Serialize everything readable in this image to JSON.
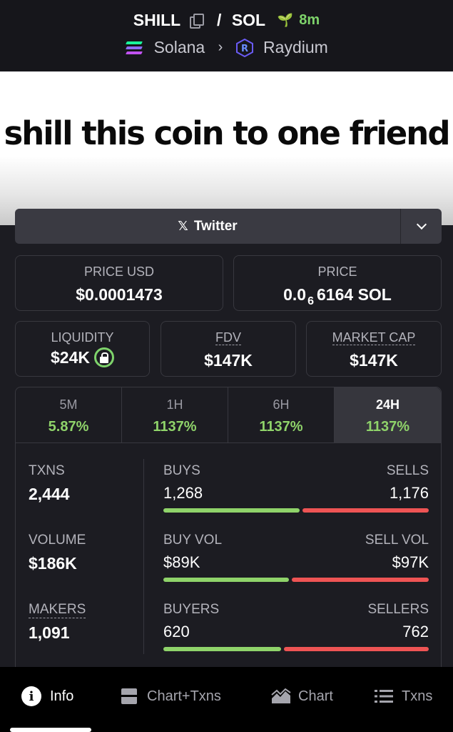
{
  "header": {
    "token": "SHILL",
    "separator": "/",
    "quote": "SOL",
    "age": "8m",
    "chain": "Solana",
    "dex": "Raydium"
  },
  "banner": {
    "text": "shill this coin to one friend"
  },
  "social": {
    "label": "Twitter"
  },
  "price_usd": {
    "label": "PRICE USD",
    "value": "$0.0001473"
  },
  "price_native": {
    "label": "PRICE",
    "prefix": "0.0",
    "zeros": "6",
    "digits": "6164 SOL"
  },
  "liquidity": {
    "label": "LIQUIDITY",
    "value": "$24K"
  },
  "fdv": {
    "label": "FDV",
    "value": "$147K"
  },
  "market_cap": {
    "label": "MARKET CAP",
    "value": "$147K"
  },
  "tabs": [
    {
      "label": "5M",
      "value": "5.87%"
    },
    {
      "label": "1H",
      "value": "1137%"
    },
    {
      "label": "6H",
      "value": "1137%"
    },
    {
      "label": "24H",
      "value": "1137%"
    }
  ],
  "stats": {
    "txns": {
      "label": "TXNS",
      "value": "2,444"
    },
    "volume": {
      "label": "VOLUME",
      "value": "$186K"
    },
    "makers": {
      "label": "MAKERS",
      "value": "1,091"
    },
    "buys": {
      "left_label": "BUYS",
      "left_value": "1,268",
      "right_label": "SELLS",
      "right_value": "1,176",
      "buy_fraction": 0.519
    },
    "vol": {
      "left_label": "BUY VOL",
      "left_value": "$89K",
      "right_label": "SELL VOL",
      "right_value": "$97K",
      "buy_fraction": 0.478
    },
    "buyers": {
      "left_label": "BUYERS",
      "left_value": "620",
      "right_label": "SELLERS",
      "right_value": "762",
      "buy_fraction": 0.449
    }
  },
  "nav": {
    "info": "Info",
    "chart_txns": "Chart+Txns",
    "chart": "Chart",
    "txns": "Txns"
  },
  "colors": {
    "positive": "#8fd36a",
    "negative": "#ee5454",
    "accent_sprout": "#7ed36b"
  }
}
